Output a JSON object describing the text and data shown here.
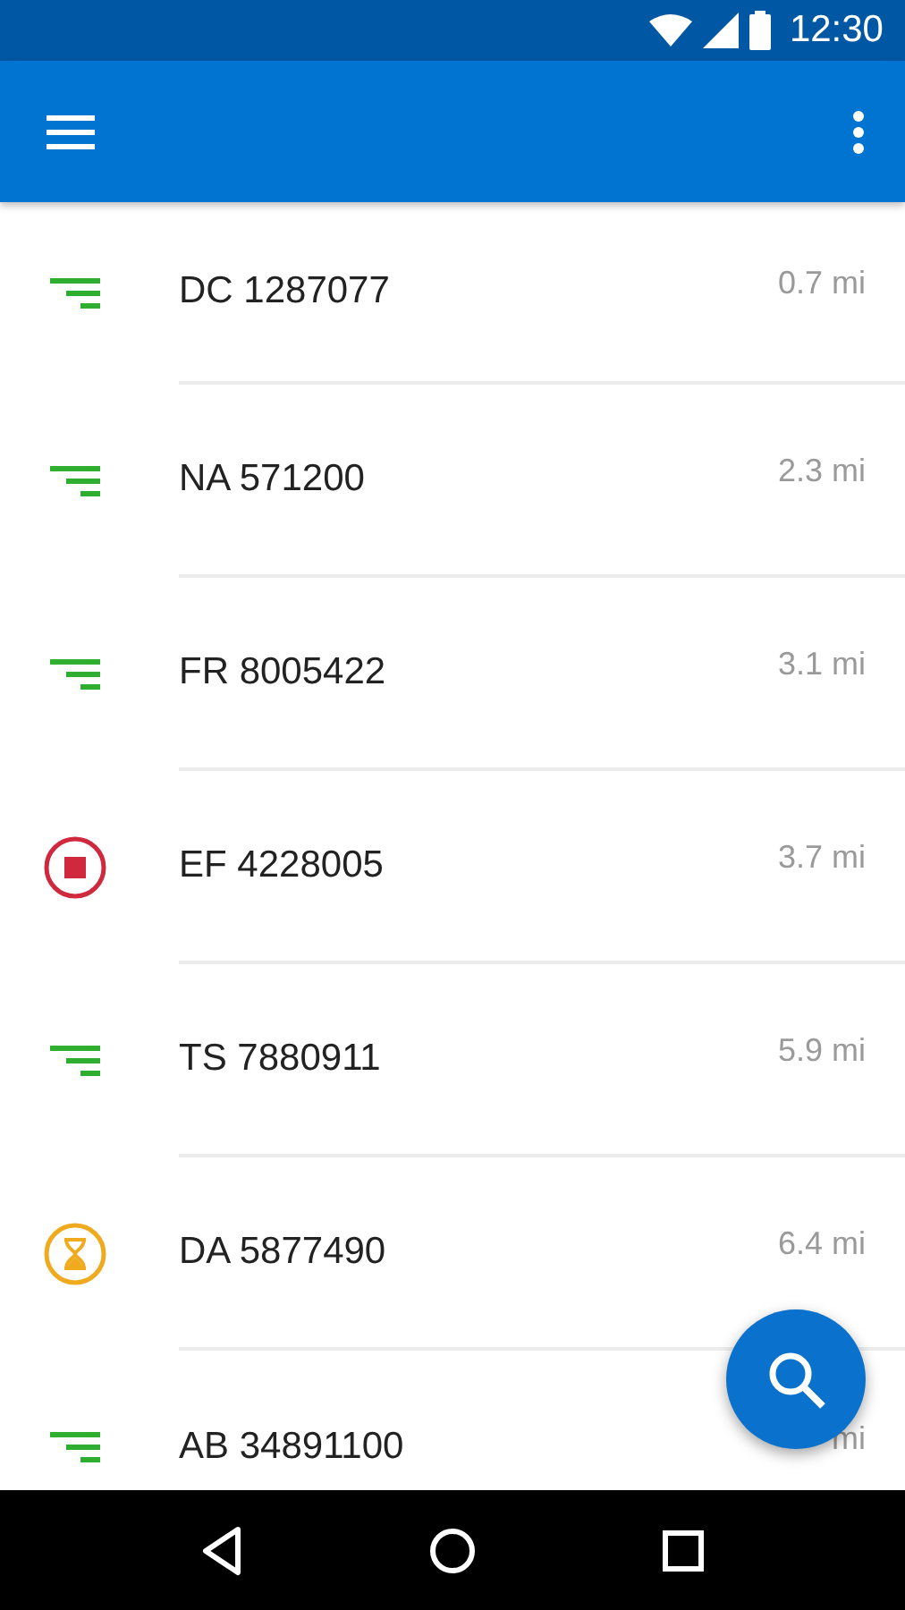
{
  "status_bar": {
    "time": "12:30"
  },
  "items": [
    {
      "code": "DC 1287077",
      "distance": "0.7 mi",
      "kind": "queued"
    },
    {
      "code": "NA 571200",
      "distance": "2.3 mi",
      "kind": "queued"
    },
    {
      "code": "FR 8005422",
      "distance": "3.1 mi",
      "kind": "queued"
    },
    {
      "code": "EF 4228005",
      "distance": "3.7 mi",
      "kind": "stopped"
    },
    {
      "code": "TS 7880911",
      "distance": "5.9 mi",
      "kind": "queued"
    },
    {
      "code": "DA 5877490",
      "distance": "6.4 mi",
      "kind": "waiting"
    },
    {
      "code": "AB 34891100",
      "distance": "mi",
      "kind": "queued"
    }
  ]
}
